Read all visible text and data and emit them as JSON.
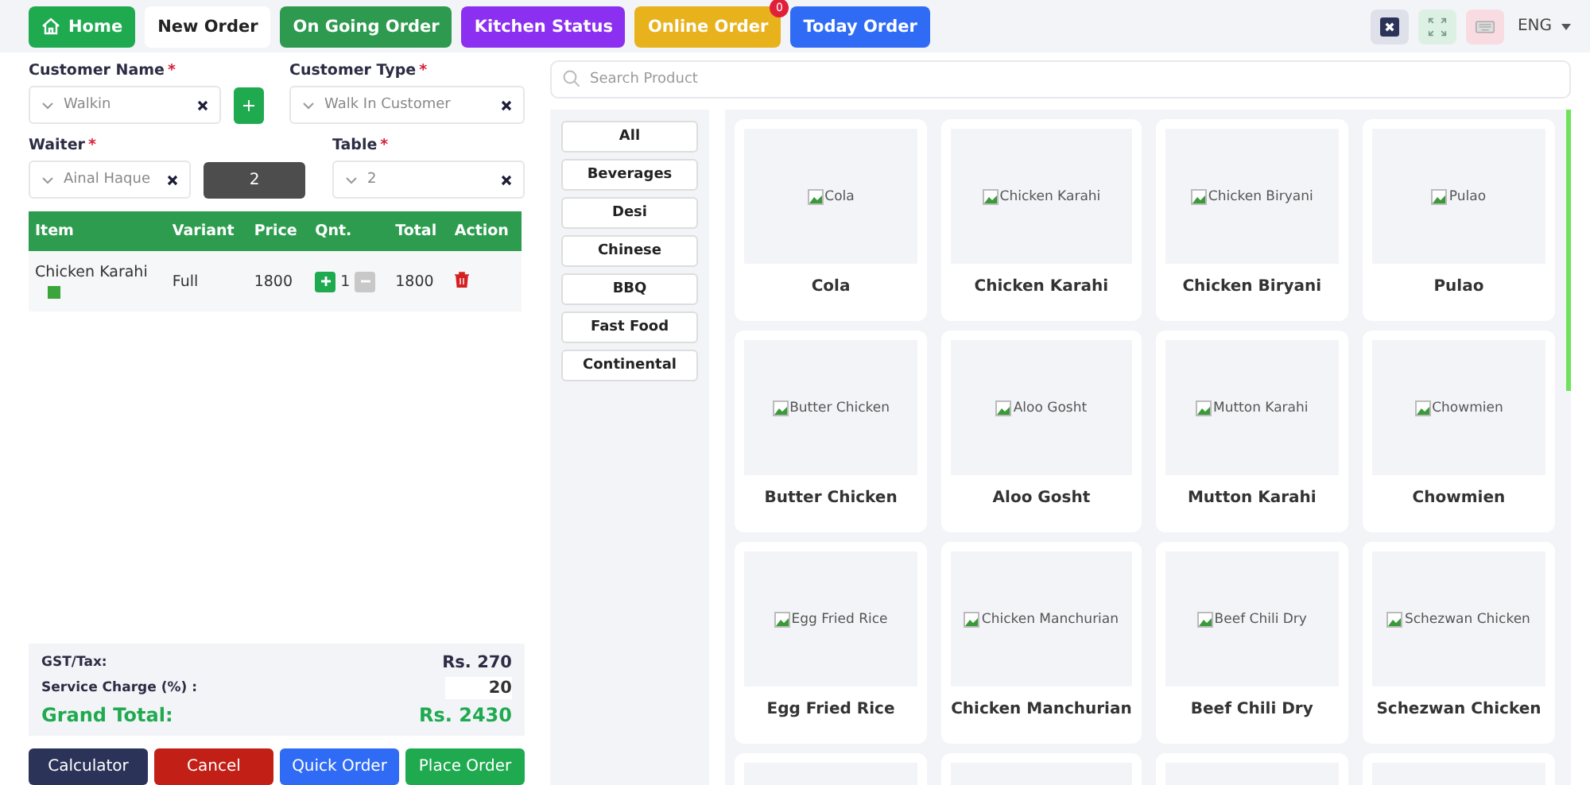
{
  "nav": {
    "buttons": [
      {
        "label": "Home",
        "kind": "home",
        "color": "#1faa50"
      },
      {
        "label": "New Order",
        "kind": "plain",
        "color": "#ffffff"
      },
      {
        "label": "On Going Order",
        "kind": "plain",
        "color": "#2e9a4f"
      },
      {
        "label": "Kitchen Status",
        "kind": "plain",
        "color": "#8b2ff0"
      },
      {
        "label": "Online Order",
        "kind": "badge",
        "color": "#e8b21c",
        "badge": "0"
      },
      {
        "label": "Today Order",
        "kind": "plain",
        "color": "#2f6bf5"
      }
    ],
    "language": "ENG"
  },
  "order_form": {
    "customer_name": {
      "label": "Customer Name",
      "required_mark": "*",
      "value": "Walkin"
    },
    "customer_type": {
      "label": "Customer Type",
      "required_mark": "*",
      "value": "Walk In Customer"
    },
    "waiter": {
      "label": "Waiter",
      "required_mark": "*",
      "value": "Ainal Haque"
    },
    "guests": "2",
    "table": {
      "label": "Table",
      "required_mark": "*",
      "value": "2"
    }
  },
  "cart": {
    "columns": [
      "Item",
      "Variant",
      "Price",
      "Qnt.",
      "Total",
      "Action"
    ],
    "rows": [
      {
        "item": "Chicken Karahi",
        "variant": "Full",
        "price": "1800",
        "qty": "1",
        "total": "1800"
      }
    ]
  },
  "summary": {
    "tax_label": "GST/Tax:",
    "tax": "Rs. 270",
    "service_label": "Service Charge (%) :",
    "service": "20",
    "grand_label": "Grand Total:",
    "grand": "Rs. 2430"
  },
  "actions": [
    {
      "label": "Calculator",
      "color": "#2b3358"
    },
    {
      "label": "Cancel",
      "color": "#c21f16"
    },
    {
      "label": "Quick Order",
      "color": "#2f6bf5"
    },
    {
      "label": "Place Order",
      "color": "#1faa50"
    }
  ],
  "search": {
    "placeholder": "Search Product"
  },
  "categories": [
    "All",
    "Beverages",
    "Desi",
    "Chinese",
    "BBQ",
    "Fast Food",
    "Continental"
  ],
  "products": [
    {
      "kind": "item",
      "name": "Cola",
      "alt": "Cola"
    },
    {
      "kind": "item",
      "name": "Chicken Karahi",
      "alt": "Chicken Karahi"
    },
    {
      "kind": "item",
      "name": "Chicken Biryani",
      "alt": "Chicken Biryani"
    },
    {
      "kind": "item",
      "name": "Pulao",
      "alt": "Pulao"
    },
    {
      "kind": "item",
      "name": "Butter Chicken",
      "alt": "Butter Chicken"
    },
    {
      "kind": "item",
      "name": "Aloo Gosht",
      "alt": "Aloo Gosht"
    },
    {
      "kind": "item",
      "name": "Mutton Karahi",
      "alt": "Mutton Karahi"
    },
    {
      "kind": "item",
      "name": "Chowmien",
      "alt": "Chowmien"
    },
    {
      "kind": "item",
      "name": "Egg Fried Rice",
      "alt": "Egg Fried Rice"
    },
    {
      "kind": "item",
      "name": "Chicken Manchurian",
      "alt": "Chicken Manchurian"
    },
    {
      "kind": "item",
      "name": "Beef Chili Dry",
      "alt": "Beef Chili Dry"
    },
    {
      "kind": "item",
      "name": "Schezwan Chicken",
      "alt": "Schezwan Chicken"
    },
    {
      "kind": "cut_off"
    },
    {
      "kind": "cut_off"
    },
    {
      "kind": "cut_off"
    },
    {
      "kind": "cut_off"
    }
  ]
}
